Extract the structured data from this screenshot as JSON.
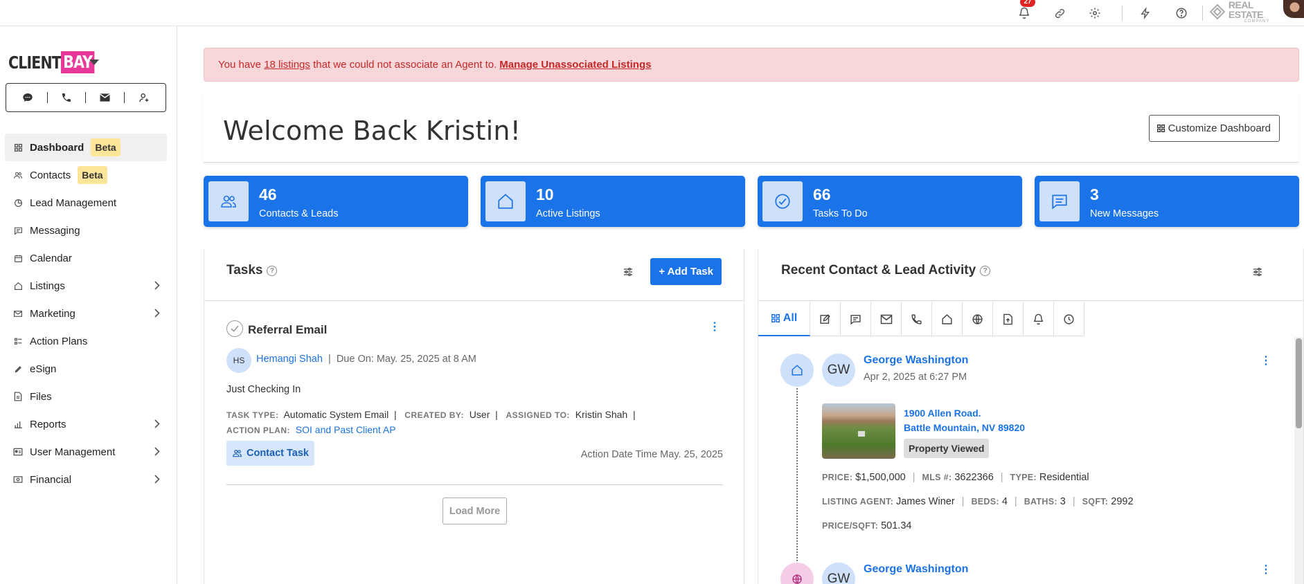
{
  "topbar": {
    "notification_count": "27",
    "logo_text": "REAL ESTATE",
    "logo_subtext": "COMPANY"
  },
  "sidebar": {
    "logo_client": "CLIENT",
    "logo_bay": "BAY",
    "items": [
      {
        "label": "Dashboard",
        "badge": "Beta",
        "icon": "grid-icon"
      },
      {
        "label": "Contacts",
        "badge": "Beta",
        "icon": "users-icon"
      },
      {
        "label": "Lead Management",
        "icon": "pie-chart-icon"
      },
      {
        "label": "Messaging",
        "icon": "chat-icon"
      },
      {
        "label": "Calendar",
        "icon": "calendar-icon"
      },
      {
        "label": "Listings",
        "icon": "home-icon",
        "has_submenu": true
      },
      {
        "label": "Marketing",
        "icon": "mail-icon",
        "has_submenu": true
      },
      {
        "label": "Action Plans",
        "icon": "list-icon"
      },
      {
        "label": "eSign",
        "icon": "pen-icon"
      },
      {
        "label": "Files",
        "icon": "file-icon"
      },
      {
        "label": "Reports",
        "icon": "bar-chart-icon",
        "has_submenu": true
      },
      {
        "label": "User Management",
        "icon": "id-card-icon",
        "has_submenu": true
      },
      {
        "label": "Financial",
        "icon": "money-icon",
        "has_submenu": true
      }
    ]
  },
  "alert": {
    "prefix": "You have",
    "link": "18 listings",
    "middle": "that we could not associate an Agent to.",
    "action": "Manage Unassociated Listings"
  },
  "welcome": {
    "title": "Welcome Back Kristin!",
    "customize_label": "Customize Dashboard"
  },
  "stats": [
    {
      "value": "46",
      "label": "Contacts & Leads"
    },
    {
      "value": "10",
      "label": "Active Listings"
    },
    {
      "value": "66",
      "label": "Tasks To Do"
    },
    {
      "value": "3",
      "label": "New Messages"
    }
  ],
  "tasks": {
    "title": "Tasks",
    "add_label": "+ Add Task",
    "item": {
      "title": "Referral Email",
      "initials": "HS",
      "owner": "Hemangi Shah",
      "due": "Due On: May. 25, 2025 at 8 AM",
      "note": "Just Checking In",
      "task_type_key": "TASK TYPE:",
      "task_type": "Automatic System Email",
      "created_by_key": "CREATED BY:",
      "created_by": "User",
      "assigned_to_key": "ASSIGNED TO:",
      "assigned_to": "Kristin Shah",
      "action_plan_key": "ACTION PLAN:",
      "action_plan": "SOI and Past Client AP",
      "tag": "Contact Task",
      "action_date": "Action Date Time May. 25, 2025"
    },
    "load_more": "Load More"
  },
  "activity": {
    "title": "Recent Contact & Lead Activity",
    "tab_all": "All",
    "entries": [
      {
        "initials": "GW",
        "name": "George Washington",
        "date": "Apr 2, 2025 at 6:27 PM",
        "address_line1": "1900 Allen Road.",
        "address_line2": "Battle Mountain, NV 89820",
        "status": "Property Viewed",
        "price_key": "PRICE:",
        "price": "$1,500,000",
        "mls_key": "MLS #:",
        "mls": "3622366",
        "type_key": "TYPE:",
        "type": "Residential",
        "agent_key": "LISTING AGENT:",
        "agent": "James Winer",
        "beds_key": "BEDS:",
        "beds": "4",
        "baths_key": "BATHS:",
        "baths": "3",
        "sqft_key": "SQFT:",
        "sqft": "2992",
        "ppsf_key": "PRICE/SQFT:",
        "ppsf": "501.34"
      },
      {
        "initials": "GW",
        "name": "George Washington"
      }
    ]
  },
  "colors": {
    "primary": "#1a73e8",
    "alert_bg": "#f8d7da",
    "alert_text": "#c62828",
    "beta_bg": "#fde59a",
    "brand_pink": "#e8399a"
  }
}
